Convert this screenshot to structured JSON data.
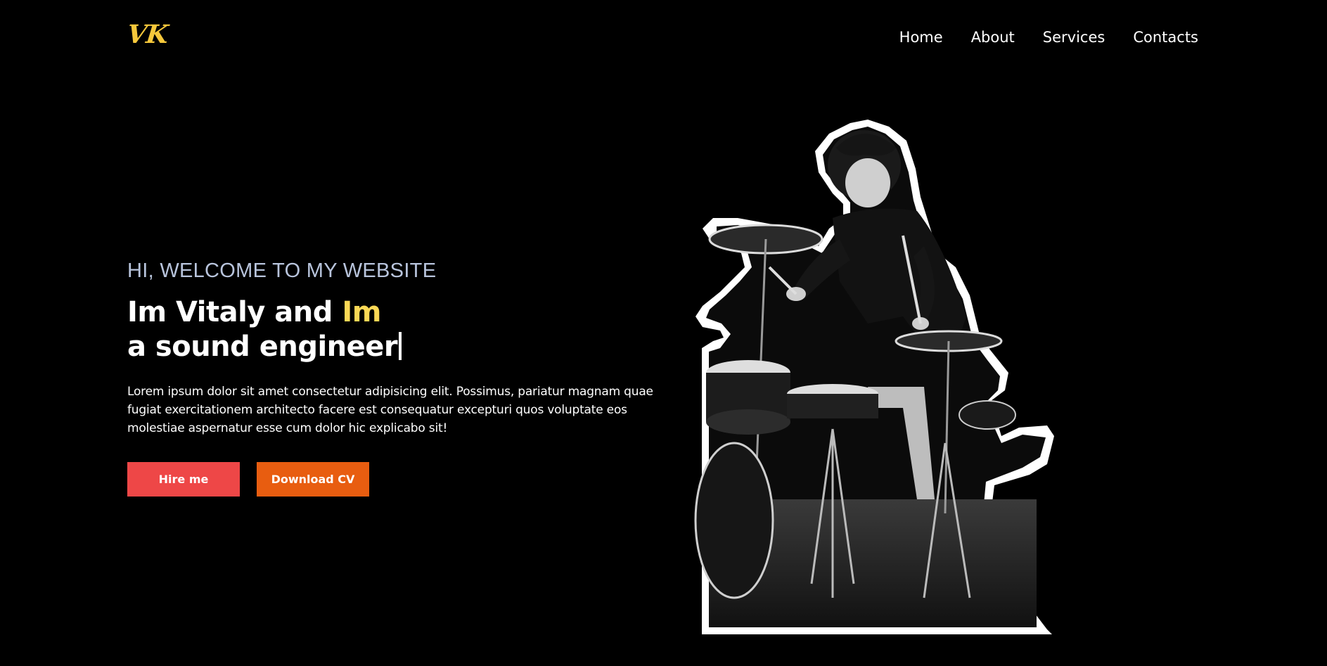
{
  "header": {
    "logo": "VK",
    "nav": [
      {
        "label": "Home"
      },
      {
        "label": "About"
      },
      {
        "label": "Services"
      },
      {
        "label": "Contacts"
      }
    ]
  },
  "hero": {
    "welcome": "HI, WELCOME TO MY WEBSITE",
    "headline_line1_a": "Im Vitaly and ",
    "headline_line1_b": "Im",
    "headline_line2": "a sound engineer",
    "description": "Lorem ipsum dolor sit amet consectetur adipisicing elit. Possimus, pariatur magnam quae fugiat exercitationem architecto facere est consequatur excepturi quos voluptate eos molestiae aspernatur esse cum dolor hic explicabo sit!",
    "hire_label": "Hire me",
    "cv_label": "Download CV"
  },
  "colors": {
    "background": "#000000",
    "logo": "#f6c83b",
    "accent": "#fbd856",
    "welcome": "#b8c4dc",
    "hire_button": "#ee4747",
    "cv_button": "#e85d10"
  },
  "icons": {
    "hero_image": "drummer-photo-cutout"
  }
}
